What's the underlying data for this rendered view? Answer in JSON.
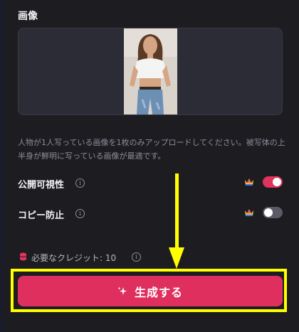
{
  "section": {
    "title": "画像"
  },
  "image": {
    "subject": "photo-of-woman"
  },
  "helper_text": "人物が1人写っている画像を1枚のみアップロードしてください。被写体の上半身が鮮明に写っている画像が最適です。",
  "settings": [
    {
      "label": "公開可視性",
      "toggle_on": true,
      "premium": true
    },
    {
      "label": "コピー防止",
      "toggle_on": false,
      "premium": true
    }
  ],
  "credits": {
    "label": "必要なクレジット: 10"
  },
  "generate_button": {
    "label": "生成する"
  },
  "colors": {
    "accent": "#de2f5e",
    "background": "#1d1c21",
    "highlight": "#ffff00"
  }
}
